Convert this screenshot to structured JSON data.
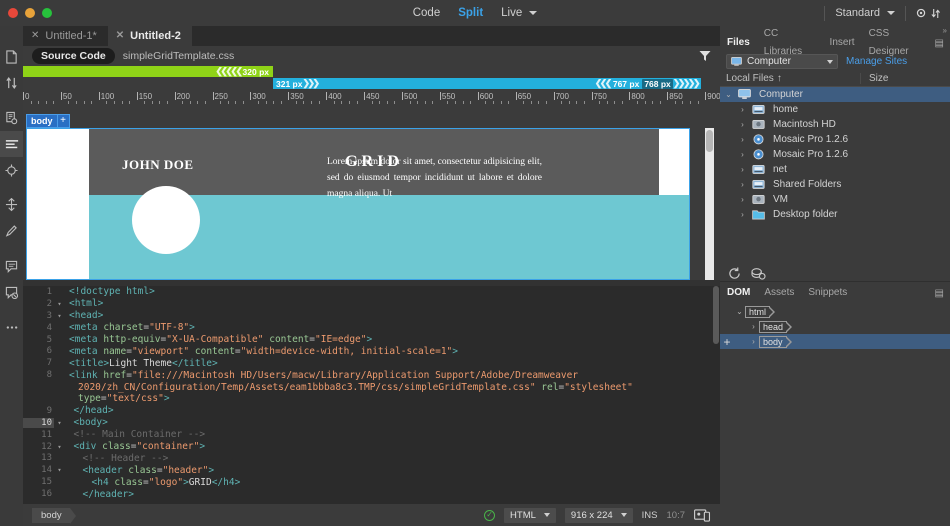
{
  "titlebar": {
    "view_modes": [
      {
        "label": "Code",
        "active": false
      },
      {
        "label": "Split",
        "active": true
      },
      {
        "label": "Live",
        "active": false
      }
    ],
    "workspace": "Standard"
  },
  "left_toolbar": {
    "icons": [
      "file-management-icon",
      "get-put-files-icon",
      "file-search-icon",
      "format-source-code-icon",
      "target-selector-icon",
      "expand-collapse-icon",
      "apply-comment-icon",
      "add-comment-icon",
      "remove-comment-icon",
      "more-options-icon"
    ]
  },
  "tabs": [
    {
      "label": "Untitled-1*",
      "active": false
    },
    {
      "label": "Untitled-2",
      "active": true
    }
  ],
  "source_bar": {
    "source_code_label": "Source Code",
    "related_file": "simpleGridTemplate.css",
    "filter_icon": "filter-icon"
  },
  "width_bars": {
    "green_label": "320 px",
    "blue_start_label": "321 px",
    "blue_mid_label": "767 px",
    "blue_end_label": "768 px",
    "green_color": "#8fd317",
    "blue_color": "#23b0dd"
  },
  "ruler": {
    "ticks": [
      0,
      50,
      100,
      150,
      200,
      250,
      300,
      350,
      400,
      450,
      500,
      550,
      600,
      650,
      700,
      750,
      800,
      850,
      900
    ],
    "unit": "px"
  },
  "document": {
    "body_tag": "body",
    "body_plus": "+",
    "page": {
      "logo": "GRID",
      "name": "JOHN DOE",
      "paragraph": "Lorem ipsum dolor sit amet, consectetur adipisicing elit, sed do eiusmod tempor incididunt ut labore et dolore magna aliqua. Ut",
      "header_color": "#5b5b5b",
      "accent_color": "#6ec8d2"
    }
  },
  "code": {
    "lines": [
      {
        "n": "1",
        "fold": "",
        "tokens": [
          {
            "t": "tag",
            "v": "<!doctype html>"
          }
        ]
      },
      {
        "n": "2",
        "fold": "▾",
        "tokens": [
          {
            "t": "tag",
            "v": "<html>"
          }
        ]
      },
      {
        "n": "3",
        "fold": "▾",
        "tokens": [
          {
            "t": "tag",
            "v": "<head>"
          }
        ]
      },
      {
        "n": "4",
        "fold": "",
        "tokens": [
          {
            "t": "tag",
            "v": "<meta "
          },
          {
            "t": "attr",
            "v": "charset"
          },
          {
            "t": "punc",
            "v": "="
          },
          {
            "t": "str",
            "v": "\"UTF-8\""
          },
          {
            "t": "tag",
            "v": ">"
          }
        ]
      },
      {
        "n": "5",
        "fold": "",
        "tokens": [
          {
            "t": "tag",
            "v": "<meta "
          },
          {
            "t": "attr",
            "v": "http-equiv"
          },
          {
            "t": "punc",
            "v": "="
          },
          {
            "t": "str",
            "v": "\"X-UA-Compatible\""
          },
          {
            "t": "attr",
            "v": " content"
          },
          {
            "t": "punc",
            "v": "="
          },
          {
            "t": "str",
            "v": "\"IE=edge\""
          },
          {
            "t": "tag",
            "v": ">"
          }
        ]
      },
      {
        "n": "6",
        "fold": "",
        "tokens": [
          {
            "t": "tag",
            "v": "<meta "
          },
          {
            "t": "attr",
            "v": "name"
          },
          {
            "t": "punc",
            "v": "="
          },
          {
            "t": "str",
            "v": "\"viewport\""
          },
          {
            "t": "attr",
            "v": " content"
          },
          {
            "t": "punc",
            "v": "="
          },
          {
            "t": "str",
            "v": "\"width=device-width, initial-scale=1\""
          },
          {
            "t": "tag",
            "v": ">"
          }
        ]
      },
      {
        "n": "7",
        "fold": "",
        "tokens": [
          {
            "t": "tag",
            "v": "<title>"
          },
          {
            "t": "txt",
            "v": "Light Theme"
          },
          {
            "t": "tag",
            "v": "</title>"
          }
        ]
      },
      {
        "n": "8",
        "fold": "",
        "tokens": [
          {
            "t": "tag",
            "v": "<link "
          },
          {
            "t": "attr",
            "v": "href"
          },
          {
            "t": "punc",
            "v": "="
          },
          {
            "t": "str",
            "v": "\"file:///Macintosh HD/Users/macw/Library/Application Support/Adobe/Dreamweaver"
          }
        ]
      },
      {
        "n": "",
        "fold": "",
        "indent": 2,
        "tokens": [
          {
            "t": "str",
            "v": "2020/zh_CN/Configuration/Temp/Assets/eam1bbba8c3.TMP/css/simpleGridTemplate.css\""
          },
          {
            "t": "attr",
            "v": " rel"
          },
          {
            "t": "punc",
            "v": "="
          },
          {
            "t": "str",
            "v": "\"stylesheet\""
          }
        ]
      },
      {
        "n": "",
        "fold": "",
        "indent": 2,
        "tokens": [
          {
            "t": "attr",
            "v": "type"
          },
          {
            "t": "punc",
            "v": "="
          },
          {
            "t": "str",
            "v": "\"text/css\""
          },
          {
            "t": "tag",
            "v": ">"
          }
        ]
      },
      {
        "n": "9",
        "fold": "",
        "indent": 1,
        "tokens": [
          {
            "t": "tag",
            "v": "</head>"
          }
        ]
      },
      {
        "n": "10",
        "fold": "▾",
        "current": true,
        "indent": 1,
        "tokens": [
          {
            "t": "tag",
            "v": "<body>"
          }
        ]
      },
      {
        "n": "11",
        "fold": "",
        "indent": 1,
        "tokens": [
          {
            "t": "com",
            "v": "<!-- Main Container -->"
          }
        ]
      },
      {
        "n": "12",
        "fold": "▾",
        "indent": 1,
        "tokens": [
          {
            "t": "tag",
            "v": "<div "
          },
          {
            "t": "attr",
            "v": "class"
          },
          {
            "t": "punc",
            "v": "="
          },
          {
            "t": "str",
            "v": "\"container\""
          },
          {
            "t": "tag",
            "v": ">"
          }
        ]
      },
      {
        "n": "13",
        "fold": "",
        "indent": 3,
        "tokens": [
          {
            "t": "com",
            "v": "<!-- Header -->"
          }
        ]
      },
      {
        "n": "14",
        "fold": "▾",
        "indent": 3,
        "tokens": [
          {
            "t": "tag",
            "v": "<header "
          },
          {
            "t": "attr",
            "v": "class"
          },
          {
            "t": "punc",
            "v": "="
          },
          {
            "t": "str",
            "v": "\"header\""
          },
          {
            "t": "tag",
            "v": ">"
          }
        ]
      },
      {
        "n": "15",
        "fold": "",
        "indent": 5,
        "tokens": [
          {
            "t": "tag",
            "v": "<h4 "
          },
          {
            "t": "attr",
            "v": "class"
          },
          {
            "t": "punc",
            "v": "="
          },
          {
            "t": "str",
            "v": "\"logo\""
          },
          {
            "t": "tag",
            "v": ">"
          },
          {
            "t": "txt",
            "v": "GRID"
          },
          {
            "t": "tag",
            "v": "</h4>"
          }
        ]
      },
      {
        "n": "16",
        "fold": "",
        "indent": 3,
        "tokens": [
          {
            "t": "tag",
            "v": "</header>"
          }
        ]
      }
    ]
  },
  "statusbar": {
    "breadcrumb": "body",
    "validation_icon": "validation-ok-icon",
    "doc_type": "HTML",
    "window_size": "916 x 224",
    "insert_mode": "INS",
    "cursor_position": "10:7",
    "device_preview_icon": "device-preview-icon"
  },
  "files_panel": {
    "tabs": [
      {
        "label": "Files",
        "active": true
      },
      {
        "label": "CC Libraries",
        "active": false
      },
      {
        "label": "Insert",
        "active": false
      },
      {
        "label": "CSS Designer",
        "active": false
      }
    ],
    "site_select": "Computer",
    "manage_sites": "Manage Sites",
    "columns": {
      "local_files": "Local Files",
      "sort_arrow": "↑",
      "size": "Size"
    },
    "rows": [
      {
        "name": "Computer",
        "icon": "computer-icon",
        "depth": 0,
        "expander": "⌄",
        "selected": true
      },
      {
        "name": "home",
        "icon": "network-drive-icon",
        "depth": 1,
        "expander": "›",
        "selected": false
      },
      {
        "name": "Macintosh HD",
        "icon": "hard-drive-icon",
        "depth": 1,
        "expander": "›",
        "selected": false
      },
      {
        "name": "Mosaic Pro 1.2.6",
        "icon": "disk-image-icon",
        "depth": 1,
        "expander": "›",
        "selected": false
      },
      {
        "name": "Mosaic Pro 1.2.6",
        "icon": "disk-image-icon",
        "depth": 1,
        "expander": "›",
        "selected": false
      },
      {
        "name": "net",
        "icon": "network-drive-icon",
        "depth": 1,
        "expander": "›",
        "selected": false
      },
      {
        "name": "Shared Folders",
        "icon": "network-drive-icon",
        "depth": 1,
        "expander": "›",
        "selected": false
      },
      {
        "name": "VM",
        "icon": "hard-drive-icon",
        "depth": 1,
        "expander": "›",
        "selected": false
      },
      {
        "name": "Desktop folder",
        "icon": "folder-icon",
        "depth": 1,
        "expander": "›",
        "selected": false
      }
    ],
    "toolbar_icons": [
      "refresh-icon",
      "connect-remote-icon"
    ]
  },
  "dom_panel": {
    "tabs": [
      {
        "label": "DOM",
        "active": true
      },
      {
        "label": "Assets",
        "active": false
      },
      {
        "label": "Snippets",
        "active": false
      }
    ],
    "nodes": [
      {
        "label": "html",
        "depth": 0,
        "expander": "⌄",
        "selected": false,
        "plus": false
      },
      {
        "label": "head",
        "depth": 1,
        "expander": "›",
        "selected": false,
        "plus": false
      },
      {
        "label": "body",
        "depth": 1,
        "expander": "›",
        "selected": true,
        "plus": true
      }
    ],
    "add_icon": "add-element-icon"
  }
}
